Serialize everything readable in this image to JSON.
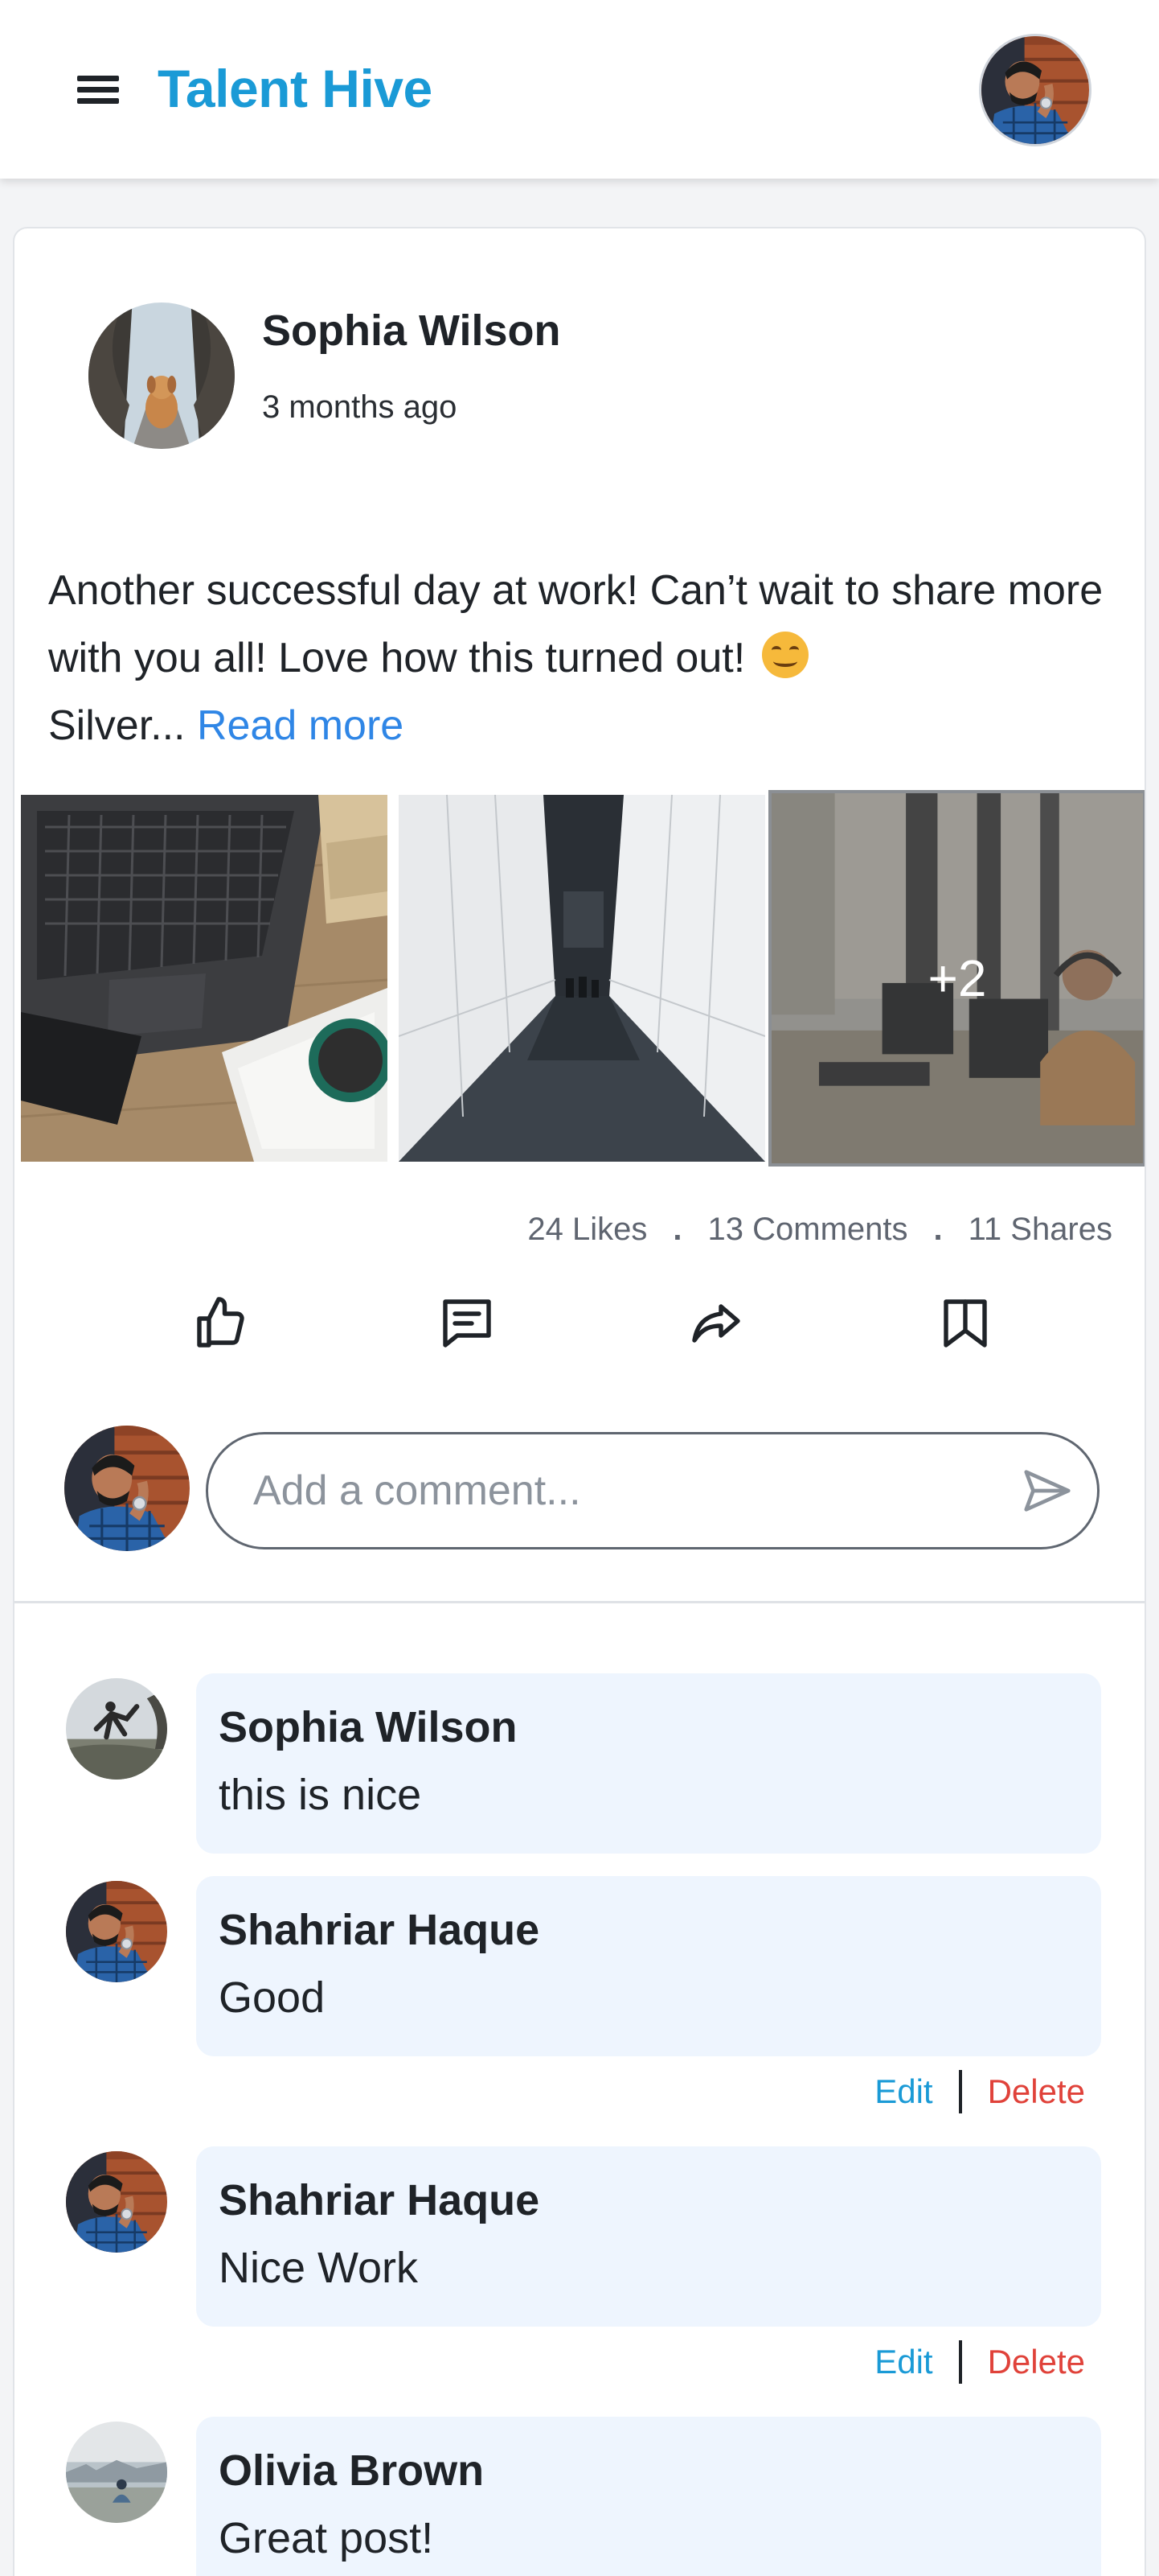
{
  "header": {
    "brand": "Talent Hive"
  },
  "post": {
    "author": "Sophia Wilson",
    "time": "3 months ago",
    "text": "Another successful day at work! Can’t wait to share more with you all! Love how this turned out!",
    "text_tail": "Silver...",
    "read_more": "Read more",
    "more_images_label": "+2",
    "stats": {
      "likes": "24 Likes",
      "comments": "13 Comments",
      "shares": "11 Shares",
      "separator": "."
    }
  },
  "comment_box": {
    "placeholder": "Add a comment..."
  },
  "comments": [
    {
      "name": "Sophia Wilson",
      "text": "this is nice"
    },
    {
      "name": "Shahriar Haque",
      "text": "Good",
      "edit": "Edit",
      "delete": "Delete"
    },
    {
      "name": "Shahriar Haque",
      "text": "Nice Work",
      "edit": "Edit",
      "delete": "Delete"
    },
    {
      "name": "Olivia Brown",
      "text": "Great post!"
    }
  ],
  "colors": {
    "brand": "#1a9ad6",
    "link": "#2f86e6",
    "delete": "#e0423a",
    "bubble": "#eef5fe"
  }
}
